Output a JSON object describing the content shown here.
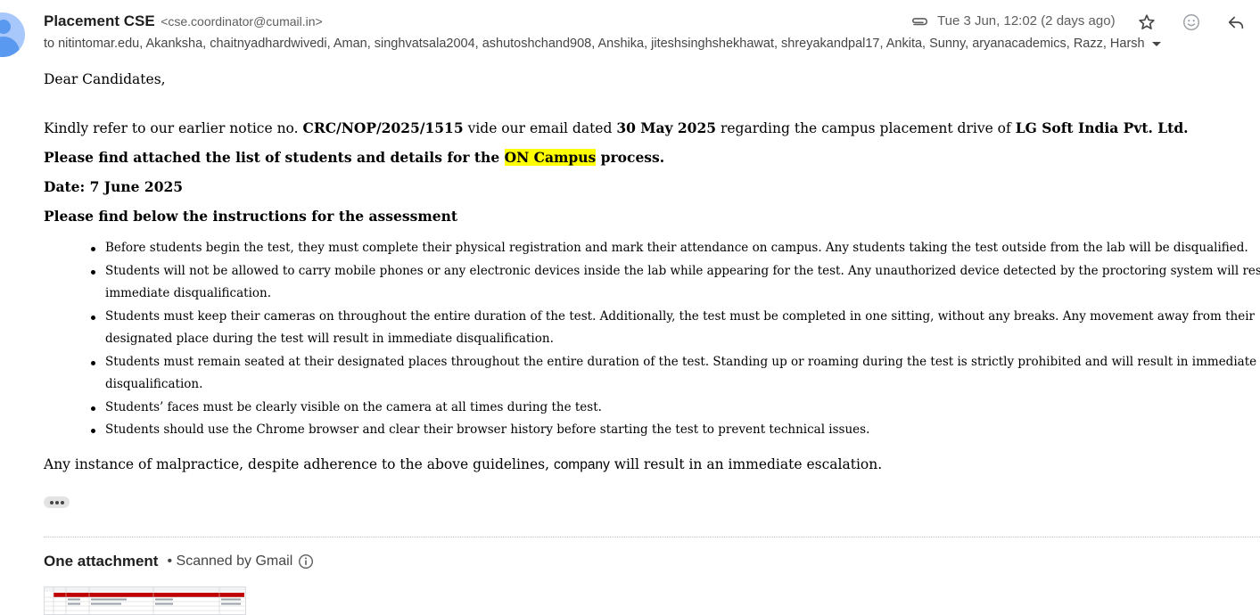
{
  "header": {
    "sender_name": "Placement CSE",
    "sender_email": "<cse.coordinator@cumail.in>",
    "date": "Tue 3 Jun, 12:02 (2 days ago)",
    "recipients": "to nitintomar.edu, Akanksha, chaitnyadhardwivedi, Aman, singhvatsala2004, ashutoshchand908, Anshika, jiteshsinghshekhawat, shreyakandpal17, Ankita, Sunny, aryanacademics, Razz, Harsh"
  },
  "icons": {
    "avatar": "avatar",
    "attachment": "paperclip-icon",
    "star": "star-icon",
    "emoji": "emoji-icon",
    "reply": "reply-icon",
    "more": "more-icon",
    "info": "info-icon"
  },
  "body": {
    "greeting": "Dear Candidates,",
    "notice": {
      "p1": "Kindly refer to our earlier notice no. ",
      "ref": "CRC/NOP/2025/1515",
      "p2": " vide our email dated ",
      "date": "30 May 2025",
      "p3": " regarding the campus placement drive of ",
      "company": "LG Soft India Pvt. Ltd."
    },
    "find_list": {
      "p1": "Please find attached the list of students and details for the ",
      "highlight": "ON Campus",
      "p2": " process."
    },
    "test_date": "Date: 7 June 2025",
    "instructions_heading": "Please find below the instructions for  the assessment",
    "instructions": [
      "Before students begin the test, they must complete their physical registration and mark their attendance on campus. Any students taking the test outside from the lab will be disqualified.",
      "Students will not be allowed to carry mobile phones or any electronic devices inside the lab while appearing for the test. Any unauthorized device detected by the proctoring system will res",
      "immediate disqualification.",
      "Students must keep their cameras on throughout the entire duration of the test. Additionally, the test must be completed in one sitting, without any breaks. Any movement away from their",
      "designated place during the test will result in immediate disqualification.",
      "Students must remain seated at their designated places throughout the entire duration of the test. Standing up or roaming during the test is strictly prohibited and will result in immediate",
      "disqualification.",
      "Students’ faces must be clearly visible on the camera at all times during the test.",
      "Students should use the Chrome browser and clear their browser history before starting the test to prevent technical issues."
    ],
    "final": {
      "p1": "Any instance of malpractice, despite adherence to the above guidelines, ",
      "company_word": "company",
      "p2": " will result in an immediate escalation."
    }
  },
  "attachments": {
    "title": "One attachment",
    "scanned": "• Scanned by Gmail"
  },
  "colors": {
    "highlight": "#ffff00",
    "avatar_bg": "#a8c7fa",
    "thumb_header": "#c00000"
  }
}
